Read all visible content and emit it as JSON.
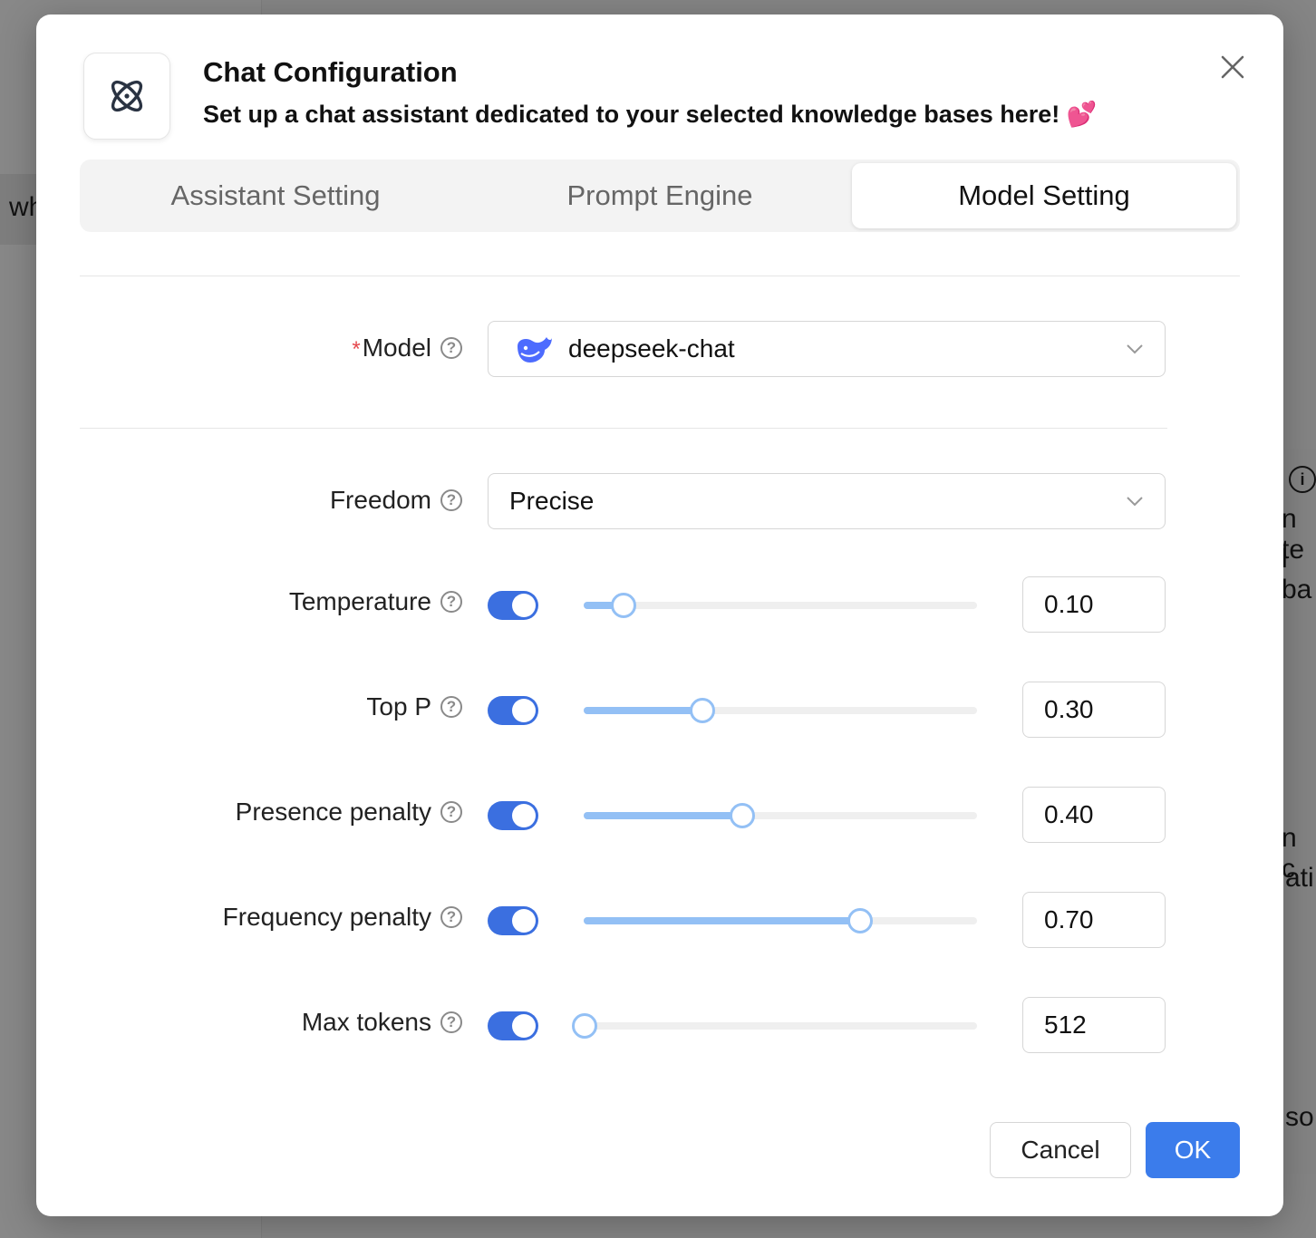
{
  "background": {
    "left_text": "wh",
    "right_texts": [
      "n te",
      "l ba",
      "n c",
      "ati",
      "so"
    ]
  },
  "dialog": {
    "title": "Chat Configuration",
    "subtitle": "Set up a chat assistant dedicated to your selected knowledge bases here! 💕",
    "logo_icon": "atom-icon",
    "close_icon": "close-icon"
  },
  "tabs": [
    {
      "label": "Assistant Setting",
      "active": false
    },
    {
      "label": "Prompt Engine",
      "active": false
    },
    {
      "label": "Model Setting",
      "active": true
    }
  ],
  "model": {
    "label": "Model",
    "required": "*",
    "value": "deepseek-chat",
    "icon": "deepseek-whale-icon"
  },
  "freedom": {
    "label": "Freedom",
    "value": "Precise"
  },
  "params": [
    {
      "label": "Temperature",
      "enabled": true,
      "value": "0.10",
      "fraction": 0.1
    },
    {
      "label": "Top P",
      "enabled": true,
      "value": "0.30",
      "fraction": 0.3
    },
    {
      "label": "Presence penalty",
      "enabled": true,
      "value": "0.40",
      "fraction": 0.4
    },
    {
      "label": "Frequency penalty",
      "enabled": true,
      "value": "0.70",
      "fraction": 0.7
    },
    {
      "label": "Max tokens",
      "enabled": true,
      "value": "512",
      "fraction": 0.0
    }
  ],
  "footer": {
    "cancel_label": "Cancel",
    "ok_label": "OK"
  },
  "colors": {
    "primary": "#3b7ceb",
    "toggle_on": "#3b6fe0",
    "slider_track": "#93c0f5"
  }
}
